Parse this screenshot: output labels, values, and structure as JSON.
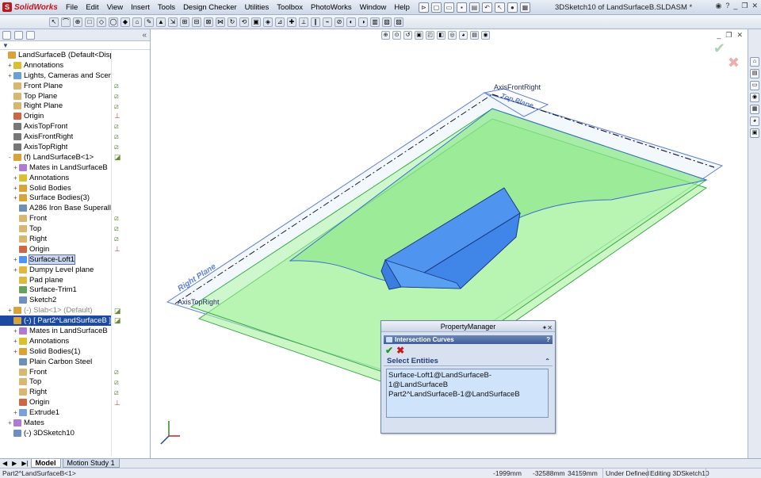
{
  "titlebar": {
    "logo": "SolidWorks",
    "menu": [
      "File",
      "Edit",
      "View",
      "Insert",
      "Tools",
      "Design Checker",
      "Utilities",
      "Toolbox",
      "PhotoWorks",
      "Window",
      "Help"
    ],
    "doc_title": "3DSketch10 of LandSurfaceB.SLDASM *"
  },
  "viewport": {
    "plane_label_right": "Right Plane",
    "label_axis_front_right": "AxisFrontRight",
    "label_axis_top_right": "AxisTopRight",
    "label_top_plane": "Top Plane",
    "colors": {
      "surface": "#8fe88f",
      "surface_fill": "#b8f5b0",
      "box": "#4f95ef",
      "plane_edge": "#5f7fd8",
      "axis": "#1a1a3a"
    }
  },
  "featuremanager": {
    "filter_icon": "filter-icon",
    "tree": [
      {
        "label": "LandSurfaceB  (Default<Display",
        "level": 0,
        "expander": "",
        "icon": "assembly"
      },
      {
        "label": "Annotations",
        "level": 1,
        "expander": "+",
        "icon": "annotation"
      },
      {
        "label": "Lights, Cameras and Scene",
        "level": 1,
        "expander": "+",
        "icon": "lights"
      },
      {
        "label": "Front Plane",
        "level": 1,
        "expander": "",
        "icon": "plane"
      },
      {
        "label": "Top Plane",
        "level": 1,
        "expander": "",
        "icon": "plane"
      },
      {
        "label": "Right Plane",
        "level": 1,
        "expander": "",
        "icon": "plane"
      },
      {
        "label": "Origin",
        "level": 1,
        "expander": "",
        "icon": "origin"
      },
      {
        "label": "AxisTopFront",
        "level": 1,
        "expander": "",
        "icon": "axis"
      },
      {
        "label": "AxisFrontRight",
        "level": 1,
        "expander": "",
        "icon": "axis"
      },
      {
        "label": "AxisTopRight",
        "level": 1,
        "expander": "",
        "icon": "axis"
      },
      {
        "label": "(f) LandSurfaceB<1>",
        "level": 1,
        "expander": "-",
        "icon": "part"
      },
      {
        "label": "Mates in LandSurfaceB",
        "level": 2,
        "expander": "+",
        "icon": "mates"
      },
      {
        "label": "Annotations",
        "level": 2,
        "expander": "+",
        "icon": "annotation"
      },
      {
        "label": "Solid Bodies",
        "level": 2,
        "expander": "+",
        "icon": "bodies"
      },
      {
        "label": "Surface Bodies(3)",
        "level": 2,
        "expander": "+",
        "icon": "bodies"
      },
      {
        "label": "A286 Iron Base Superall",
        "level": 2,
        "expander": "",
        "icon": "material"
      },
      {
        "label": "Front",
        "level": 2,
        "expander": "",
        "icon": "plane"
      },
      {
        "label": "Top",
        "level": 2,
        "expander": "",
        "icon": "plane"
      },
      {
        "label": "Right",
        "level": 2,
        "expander": "",
        "icon": "plane"
      },
      {
        "label": "Origin",
        "level": 2,
        "expander": "",
        "icon": "origin"
      },
      {
        "label": "Surface-Loft1",
        "level": 2,
        "expander": "+",
        "icon": "loft",
        "state": "hl"
      },
      {
        "label": "Dumpy Level plane",
        "level": 2,
        "expander": "+",
        "icon": "folder"
      },
      {
        "label": "Pad plane",
        "level": 2,
        "expander": "",
        "icon": "folder"
      },
      {
        "label": "Surface-Trim1",
        "level": 2,
        "expander": "",
        "icon": "trim"
      },
      {
        "label": "Sketch2",
        "level": 2,
        "expander": "",
        "icon": "sketch"
      },
      {
        "label": "(-) Slab<1> (Default)",
        "level": 1,
        "expander": "+",
        "icon": "part",
        "state": "sup"
      },
      {
        "label": "(-) [ Part2^LandSurfaceB ]-",
        "level": 1,
        "expander": "-",
        "icon": "part",
        "state": "sel"
      },
      {
        "label": "Mates in LandSurfaceB",
        "level": 2,
        "expander": "+",
        "icon": "mates"
      },
      {
        "label": "Annotations",
        "level": 2,
        "expander": "+",
        "icon": "annotation"
      },
      {
        "label": "Solid Bodies(1)",
        "level": 2,
        "expander": "+",
        "icon": "bodies"
      },
      {
        "label": "Plain Carbon Steel",
        "level": 2,
        "expander": "",
        "icon": "material"
      },
      {
        "label": "Front",
        "level": 2,
        "expander": "",
        "icon": "plane"
      },
      {
        "label": "Top",
        "level": 2,
        "expander": "",
        "icon": "plane"
      },
      {
        "label": "Right",
        "level": 2,
        "expander": "",
        "icon": "plane"
      },
      {
        "label": "Origin",
        "level": 2,
        "expander": "",
        "icon": "origin"
      },
      {
        "label": "Extrude1",
        "level": 2,
        "expander": "+",
        "icon": "extrude"
      },
      {
        "label": "Mates",
        "level": 1,
        "expander": "+",
        "icon": "mates"
      },
      {
        "label": "(-) 3DSketch10",
        "level": 1,
        "expander": "",
        "icon": "sketch"
      }
    ]
  },
  "bottom_tabs": [
    "Model",
    "Motion Study 1"
  ],
  "statusbar": {
    "component": "Part2^LandSurfaceB<1>",
    "x": "-1999mm",
    "y": "-32588mm",
    "z": "34159mm",
    "status": "Under Defined",
    "mode": "Editing 3DSketch10"
  },
  "property_manager": {
    "title": "PropertyManager",
    "feature_name": "Intersection Curves",
    "help": "?",
    "ok_icon": "check-icon",
    "cancel_icon": "close-icon",
    "section_title": "Select Entities",
    "selections": [
      "Surface-Loft1@LandSurfaceB-1@LandSurfaceB",
      "Part2^LandSurfaceB-1@LandSurfaceB"
    ]
  }
}
